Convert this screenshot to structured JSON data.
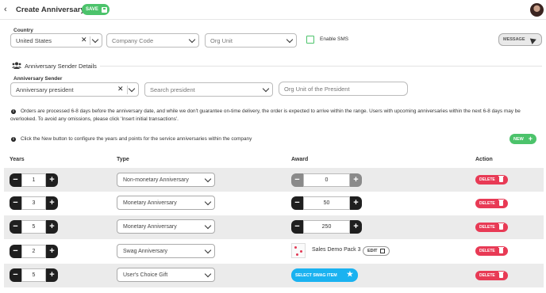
{
  "header": {
    "title": "Create Anniversary",
    "save_label": "SAVE"
  },
  "filters": {
    "country_label": "Country",
    "country_value": "United States",
    "company_code_placeholder": "Company Code",
    "org_unit_placeholder": "Org Unit",
    "enable_sms_label": "Enable SMS",
    "message_label": "MESSAGE"
  },
  "sender": {
    "section_title": "Anniversary Sender Details",
    "sender_label": "Anniversary Sender",
    "sender_value": "Anniversary president",
    "search_placeholder": "Search president",
    "org_unit_president_placeholder": "Org Unit of the President"
  },
  "info": {
    "notice": "Orders are processed 6-8 days before the anniversary date, and while we don't guarantee on-time delivery, the order is expected to arrive within the range. Users with upcoming anniversaries within the next 6-8 days may be overlooked. To avoid any omissions, please click 'Insert initial transactions'.",
    "new_hint": "Click the New button to configure the years and points for the service anniversaries within the company",
    "new_label": "NEW"
  },
  "table": {
    "headers": {
      "years": "Years",
      "type": "Type",
      "award": "Award",
      "action": "Action"
    },
    "rows": [
      {
        "years": "1",
        "type": "Non-monetary Anniversary",
        "award": "0",
        "delete": "DELETE"
      },
      {
        "years": "3",
        "type": "Monetary Anniversary",
        "award": "50",
        "delete": "DELETE"
      },
      {
        "years": "5",
        "type": "Monetary Anniversary",
        "award": "250",
        "delete": "DELETE"
      },
      {
        "years": "2",
        "type": "Swag Anniversary",
        "award_item": "Sales Demo Pack 3",
        "edit_label": "EDIT",
        "delete": "DELETE"
      },
      {
        "years": "5",
        "type": "User's Choice Gift",
        "select_swag_label": "SELECT SWAG ITEM",
        "delete": "DELETE"
      }
    ]
  },
  "colors": {
    "green": "#4cc36b",
    "red": "#e83a55",
    "blue": "#1ab2f0",
    "dark": "#1f1f1f"
  }
}
